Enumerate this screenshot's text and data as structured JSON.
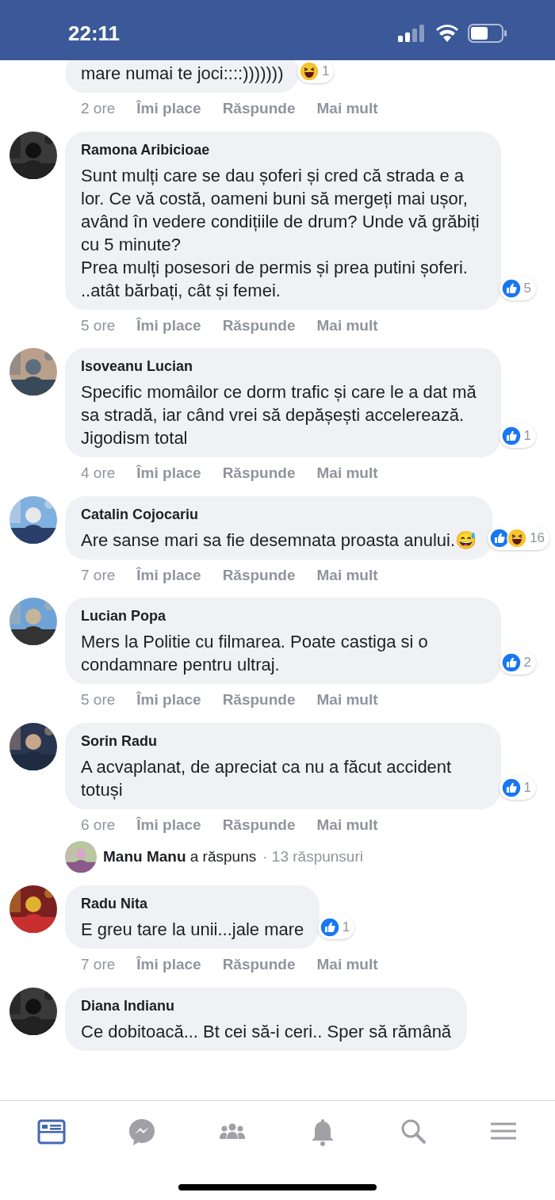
{
  "status_bar": {
    "time": "22:11"
  },
  "comments": [
    {
      "kind": "comment",
      "text": "mare numai te joci::::)))))))",
      "reactions": [
        {
          "kind": "haha"
        }
      ],
      "reaction_count": "1",
      "time": "2 ore",
      "actions": [
        "Îmi place",
        "Răspunde",
        "Mai mult"
      ]
    },
    {
      "kind": "comment",
      "author": "Ramona Aribicioae",
      "text": "Sunt mulți care se dau șoferi și cred că strada e a lor. Ce vă costă, oameni buni să mergeți mai ușor, având în vedere condițiile de drum? Unde vă grăbiți cu 5 minute?\nPrea mulți posesori de permis și prea putini șoferi. ..atât bărbați, cât și femei.",
      "reactions": [
        {
          "kind": "like"
        }
      ],
      "reaction_count": "5",
      "time": "5 ore",
      "actions": [
        "Îmi place",
        "Răspunde",
        "Mai mult"
      ]
    },
    {
      "kind": "comment",
      "author": "Isoveanu Lucian",
      "text": "Specific momâilor ce dorm trafic și care le a dat mă sa stradă, iar când vrei să depășești accelerează. Jigodism total",
      "reactions": [
        {
          "kind": "like"
        }
      ],
      "reaction_count": "1",
      "time": "4 ore",
      "actions": [
        "Îmi place",
        "Răspunde",
        "Mai mult"
      ]
    },
    {
      "kind": "comment",
      "author": "Catalin Cojocariu",
      "text": "Are sanse mari sa fie desemnata proasta anului.😅",
      "reactions": [
        {
          "kind": "like"
        },
        {
          "kind": "haha"
        }
      ],
      "reaction_count": "16",
      "time": "7 ore",
      "actions": [
        "Îmi place",
        "Răspunde",
        "Mai mult"
      ]
    },
    {
      "kind": "comment",
      "author": "Lucian Popa",
      "text": "Mers la Politie cu filmarea. Poate castiga si o condamnare pentru ultraj.",
      "reactions": [
        {
          "kind": "like"
        }
      ],
      "reaction_count": "2",
      "time": "5 ore",
      "actions": [
        "Îmi place",
        "Răspunde",
        "Mai mult"
      ]
    },
    {
      "kind": "comment",
      "author": "Sorin Radu",
      "text": "A acvaplanat, de apreciat ca nu a făcut accident totuși",
      "reactions": [
        {
          "kind": "like"
        }
      ],
      "reaction_count": "1",
      "time": "6 ore",
      "actions": [
        "Îmi place",
        "Răspunde",
        "Mai mult"
      ]
    },
    {
      "kind": "replies",
      "text": "**Manu Manu** a răspuns",
      "count": "· 13 răspunsuri"
    },
    {
      "kind": "comment",
      "author": "Radu Nita",
      "text": "E greu tare la unii...jale mare",
      "reactions": [
        {
          "kind": "like"
        }
      ],
      "reaction_count": "1",
      "time": "7 ore",
      "actions": [
        "Îmi place",
        "Răspunde",
        "Mai mult"
      ]
    },
    {
      "kind": "comment",
      "author": "Diana Indianu",
      "text": "Ce dobitoacă... Bt cei să-i ceri.. Sper să rămână"
    }
  ],
  "nav": [
    {
      "kind": "news",
      "selected": true
    },
    {
      "kind": "messenger",
      "selected": false
    },
    {
      "kind": "groups",
      "selected": false
    },
    {
      "kind": "bell",
      "selected": false
    },
    {
      "kind": "search",
      "selected": false
    },
    {
      "kind": "menu",
      "selected": false
    }
  ]
}
